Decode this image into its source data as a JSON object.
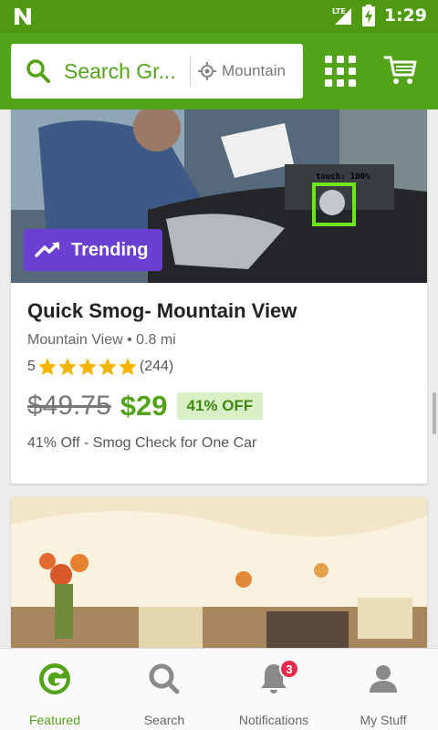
{
  "status_bar": {
    "network": "LTE",
    "time": "1:29"
  },
  "header": {
    "search_placeholder": "Search Gr...",
    "location": "Mountain"
  },
  "deals": [
    {
      "badge": "Trending",
      "title": "Quick Smog- Mountain View",
      "location": "Mountain View",
      "distance": "0.8 mi",
      "rating": "5",
      "review_count": "(244)",
      "stars": 5,
      "old_price": "$49.75",
      "new_price": "$29",
      "discount": "41% OFF",
      "description": "41% Off - Smog Check for One Car",
      "overlay_label": "touch: 100%"
    }
  ],
  "bottom_nav": {
    "items": [
      {
        "label": "Featured",
        "icon": "groupon-g-icon"
      },
      {
        "label": "Search",
        "icon": "search-icon"
      },
      {
        "label": "Notifications",
        "icon": "bell-icon",
        "badge": "3"
      },
      {
        "label": "My Stuff",
        "icon": "person-icon"
      }
    ]
  },
  "colors": {
    "brand_green": "#53a318",
    "status_green": "#4f9a11",
    "trending_purple": "#6a3fd1",
    "star_gold": "#f4b400",
    "badge_red": "#e8294a"
  }
}
